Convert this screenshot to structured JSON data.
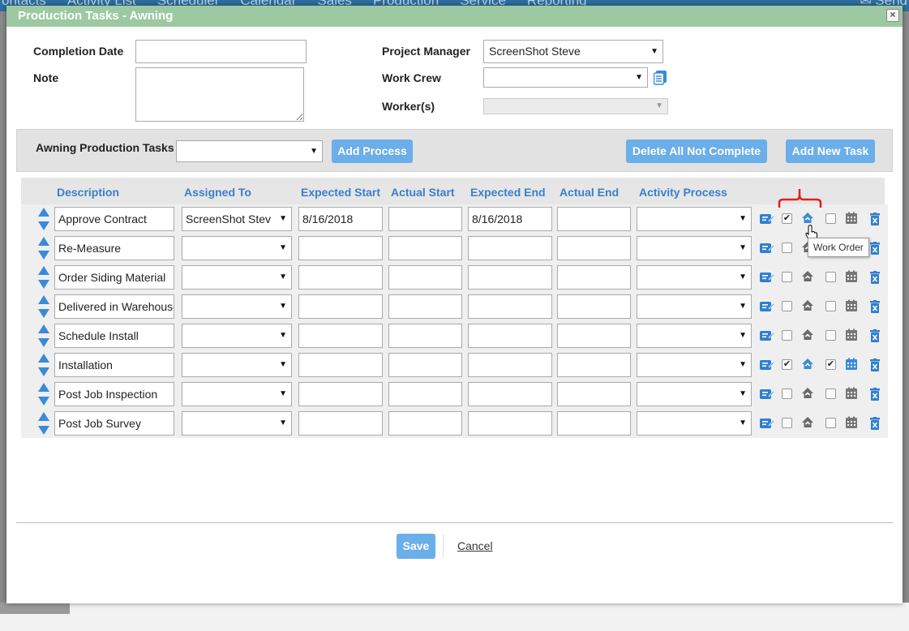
{
  "background_nav": [
    "ontacts",
    "Activity List",
    "Scheduler",
    "Calendar",
    "Sales",
    "Production",
    "Service",
    "Reporting"
  ],
  "background_send": "Send",
  "modal": {
    "title": "Production Tasks - Awning",
    "close_label": "×"
  },
  "form": {
    "completion_date_label": "Completion Date",
    "completion_date_value": "",
    "note_label": "Note",
    "note_value": "",
    "project_manager_label": "Project Manager",
    "project_manager_value": "ScreenShot Steve",
    "work_crew_label": "Work Crew",
    "work_crew_value": "",
    "workers_label": "Worker(s)",
    "workers_value": ""
  },
  "tasks_bar": {
    "label": "Awning Production Tasks",
    "process_value": "",
    "add_process": "Add Process",
    "delete_all": "Delete All Not Complete",
    "add_new_task": "Add New Task"
  },
  "columns": {
    "description": "Description",
    "assigned_to": "Assigned To",
    "expected_start": "Expected Start",
    "actual_start": "Actual Start",
    "expected_end": "Expected End",
    "actual_end": "Actual End",
    "activity_process": "Activity Process"
  },
  "tasks": [
    {
      "description": "Approve Contract",
      "assigned_to": "ScreenShot Stev",
      "expected_start": "8/16/2018",
      "actual_start": "",
      "expected_end": "8/16/2018",
      "actual_end": "",
      "activity_process": "",
      "work_order_checked": true,
      "calendar_checked": false,
      "active": true
    },
    {
      "description": "Re-Measure",
      "assigned_to": "",
      "expected_start": "",
      "actual_start": "",
      "expected_end": "",
      "actual_end": "",
      "activity_process": "",
      "work_order_checked": false,
      "calendar_checked": false,
      "active": false
    },
    {
      "description": "Order Siding Material",
      "assigned_to": "",
      "expected_start": "",
      "actual_start": "",
      "expected_end": "",
      "actual_end": "",
      "activity_process": "",
      "work_order_checked": false,
      "calendar_checked": false,
      "active": false
    },
    {
      "description": "Delivered in Warehouse",
      "assigned_to": "",
      "expected_start": "",
      "actual_start": "",
      "expected_end": "",
      "actual_end": "",
      "activity_process": "",
      "work_order_checked": false,
      "calendar_checked": false,
      "active": false
    },
    {
      "description": "Schedule Install",
      "assigned_to": "",
      "expected_start": "",
      "actual_start": "",
      "expected_end": "",
      "actual_end": "",
      "activity_process": "",
      "work_order_checked": false,
      "calendar_checked": false,
      "active": false
    },
    {
      "description": "Installation",
      "assigned_to": "",
      "expected_start": "",
      "actual_start": "",
      "expected_end": "",
      "actual_end": "",
      "activity_process": "",
      "work_order_checked": true,
      "calendar_checked": true,
      "active": true
    },
    {
      "description": "Post Job Inspection",
      "assigned_to": "",
      "expected_start": "",
      "actual_start": "",
      "expected_end": "",
      "actual_end": "",
      "activity_process": "",
      "work_order_checked": false,
      "calendar_checked": false,
      "active": false
    },
    {
      "description": "Post Job Survey",
      "assigned_to": "",
      "expected_start": "",
      "actual_start": "",
      "expected_end": "",
      "actual_end": "",
      "activity_process": "",
      "work_order_checked": false,
      "calendar_checked": false,
      "active": false
    }
  ],
  "tooltip": "Work Order",
  "footer": {
    "save": "Save",
    "cancel": "Cancel"
  },
  "colors": {
    "title_bar": "#9cc9a2",
    "accent_blue": "#3a7fcc",
    "button_blue": "#6aaeea",
    "highlight_red": "#e02020"
  }
}
